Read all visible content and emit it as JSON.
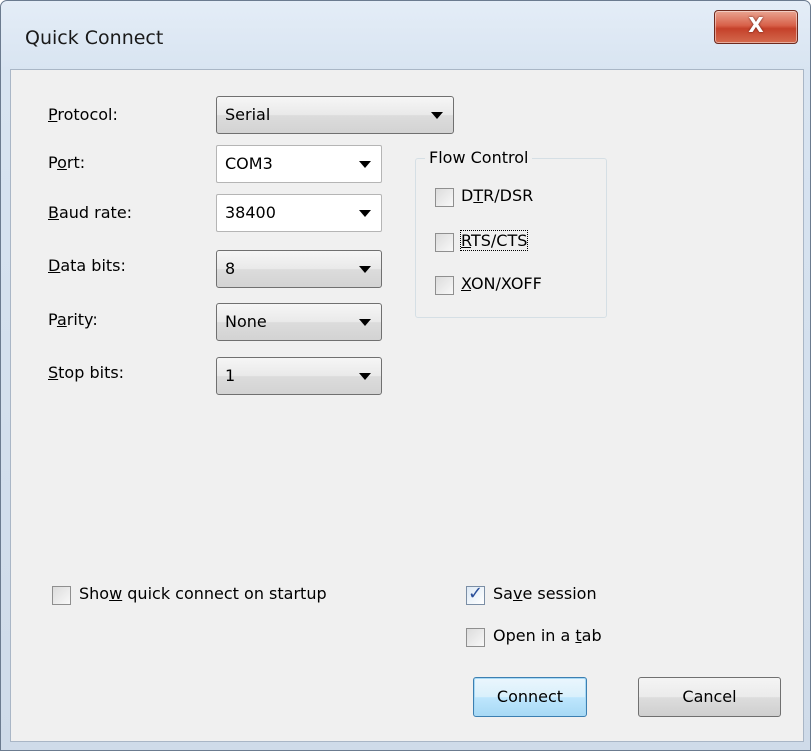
{
  "window": {
    "title": "Quick Connect",
    "close_glyph": "X"
  },
  "fields": {
    "protocol": {
      "label": "Protocol:",
      "value": "Serial"
    },
    "port": {
      "label": "Port:",
      "value": "COM3"
    },
    "baud_rate": {
      "label": "Baud rate:",
      "value": "38400"
    },
    "data_bits": {
      "label": "Data bits:",
      "value": "8"
    },
    "parity": {
      "label": "Parity:",
      "value": "None"
    },
    "stop_bits": {
      "label": "Stop bits:",
      "value": "1"
    }
  },
  "flow_control": {
    "title": "Flow Control",
    "items": [
      {
        "label": "DTR/DSR",
        "checked": false
      },
      {
        "label": "RTS/CTS",
        "checked": false
      },
      {
        "label": "XON/XOFF",
        "checked": false
      }
    ]
  },
  "options": {
    "show_on_startup": {
      "label": "Show quick connect on startup",
      "checked": false
    },
    "save_session": {
      "label": "Save session",
      "checked": true
    },
    "open_in_tab": {
      "label": "Open in a tab",
      "checked": false
    }
  },
  "buttons": {
    "connect": "Connect",
    "cancel": "Cancel"
  },
  "colors": {
    "title_bar": "#dce7f3",
    "client": "#f0f0f0",
    "default_button": "#bee6fd",
    "close_button": "#c7432b"
  }
}
